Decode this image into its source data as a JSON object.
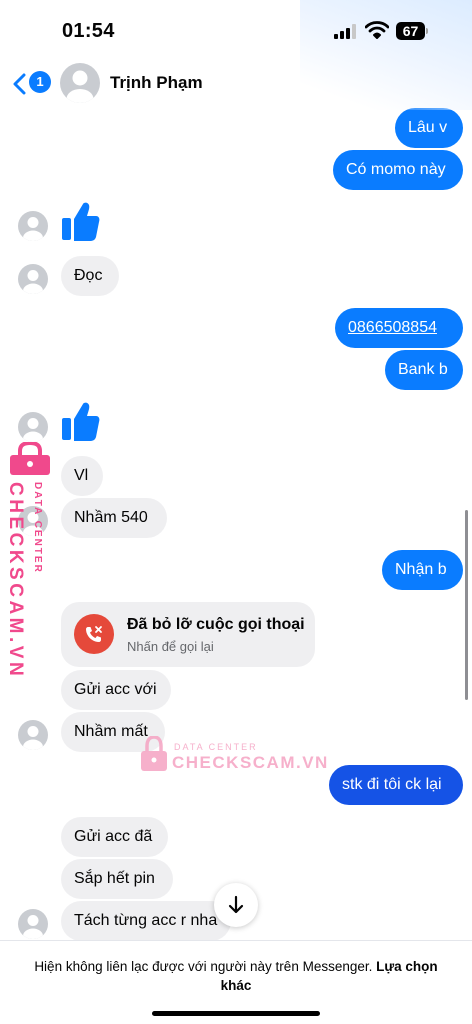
{
  "status_bar": {
    "time": "01:54",
    "battery": "67"
  },
  "header": {
    "back_badge": "1",
    "contact_name": "Trịnh Phạm"
  },
  "messages": {
    "m1": "Lâu v",
    "m2": "Có momo này",
    "m3": "Đọc",
    "m4": "0866508854",
    "m5": "Bank b",
    "m6": "Vl",
    "m7": "Nhầm 540",
    "m8": "Nhận b",
    "m9": "Gửi acc với",
    "m10": "Nhầm mất",
    "m11": "stk đi tôi ck lại",
    "m12": "Gửi acc đã",
    "m13": "Sắp hết pin",
    "m14": "Tách từng acc r nha"
  },
  "missed_call": {
    "title": "Đã bỏ lỡ cuộc gọi thoại",
    "subtitle": "Nhấn để gọi lại"
  },
  "watermark": {
    "brand": "CHECKSCAM.VN",
    "tagline": "DATA CENTER"
  },
  "footer": {
    "notice": "Hiện không liên lạc được với người này trên Messenger.",
    "link": "Lựa chọn khác"
  },
  "colors": {
    "outgoing_bubble": "#0a7cff",
    "incoming_bubble": "#efeff1",
    "like_icon": "#0a7cff",
    "missed_call_icon": "#e5493a",
    "watermark": "#f0498c"
  }
}
